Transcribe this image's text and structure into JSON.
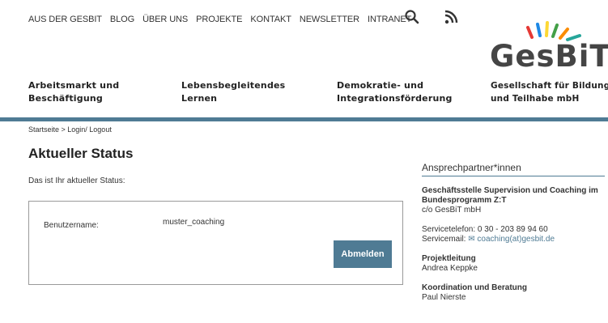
{
  "topnav": {
    "items": [
      "AUS DER GESBIT",
      "BLOG",
      "ÜBER UNS",
      "PROJEKTE",
      "KONTAKT",
      "NEWSLETTER",
      "INTRANET"
    ]
  },
  "icons": {
    "search": "search-icon",
    "rss": "rss-icon"
  },
  "logo": {
    "word": "GesBiT",
    "tagline": "Gesellschaft für Bildung\nund Teilhabe mbH"
  },
  "mainnav": [
    "Arbeitsmarkt und\nBeschäftigung",
    "Lebensbegleitendes\nLernen",
    "Demokratie- und\nIntegrationsförderung"
  ],
  "breadcrumb": "Startseite > Login/ Logout",
  "main": {
    "title": "Aktueller Status",
    "intro": "Das ist Ihr aktueller Status:",
    "username_label": "Benutzername:",
    "username_value": "muster_coaching",
    "logout_button": "Abmelden"
  },
  "sidebar": {
    "heading": "Ansprechpartner*innen",
    "office_title": "Geschäftsstelle Supervision und Coaching im Bundesprogramm Z:T",
    "office_line": "c/o GesBiT mbH",
    "phone": "Servicetelefon: 0 30 - 203 89 94 60",
    "mail_label": "Servicemail:",
    "mail_value": "coaching(at)gesbit.de",
    "lead_title": "Projektleitung",
    "lead_name": "Andrea Keppke",
    "coord_title": "Koordination und Beratung",
    "coord_name": "Paul Nierste"
  },
  "colors": {
    "accent": "#4f7b94",
    "text": "#222222"
  }
}
